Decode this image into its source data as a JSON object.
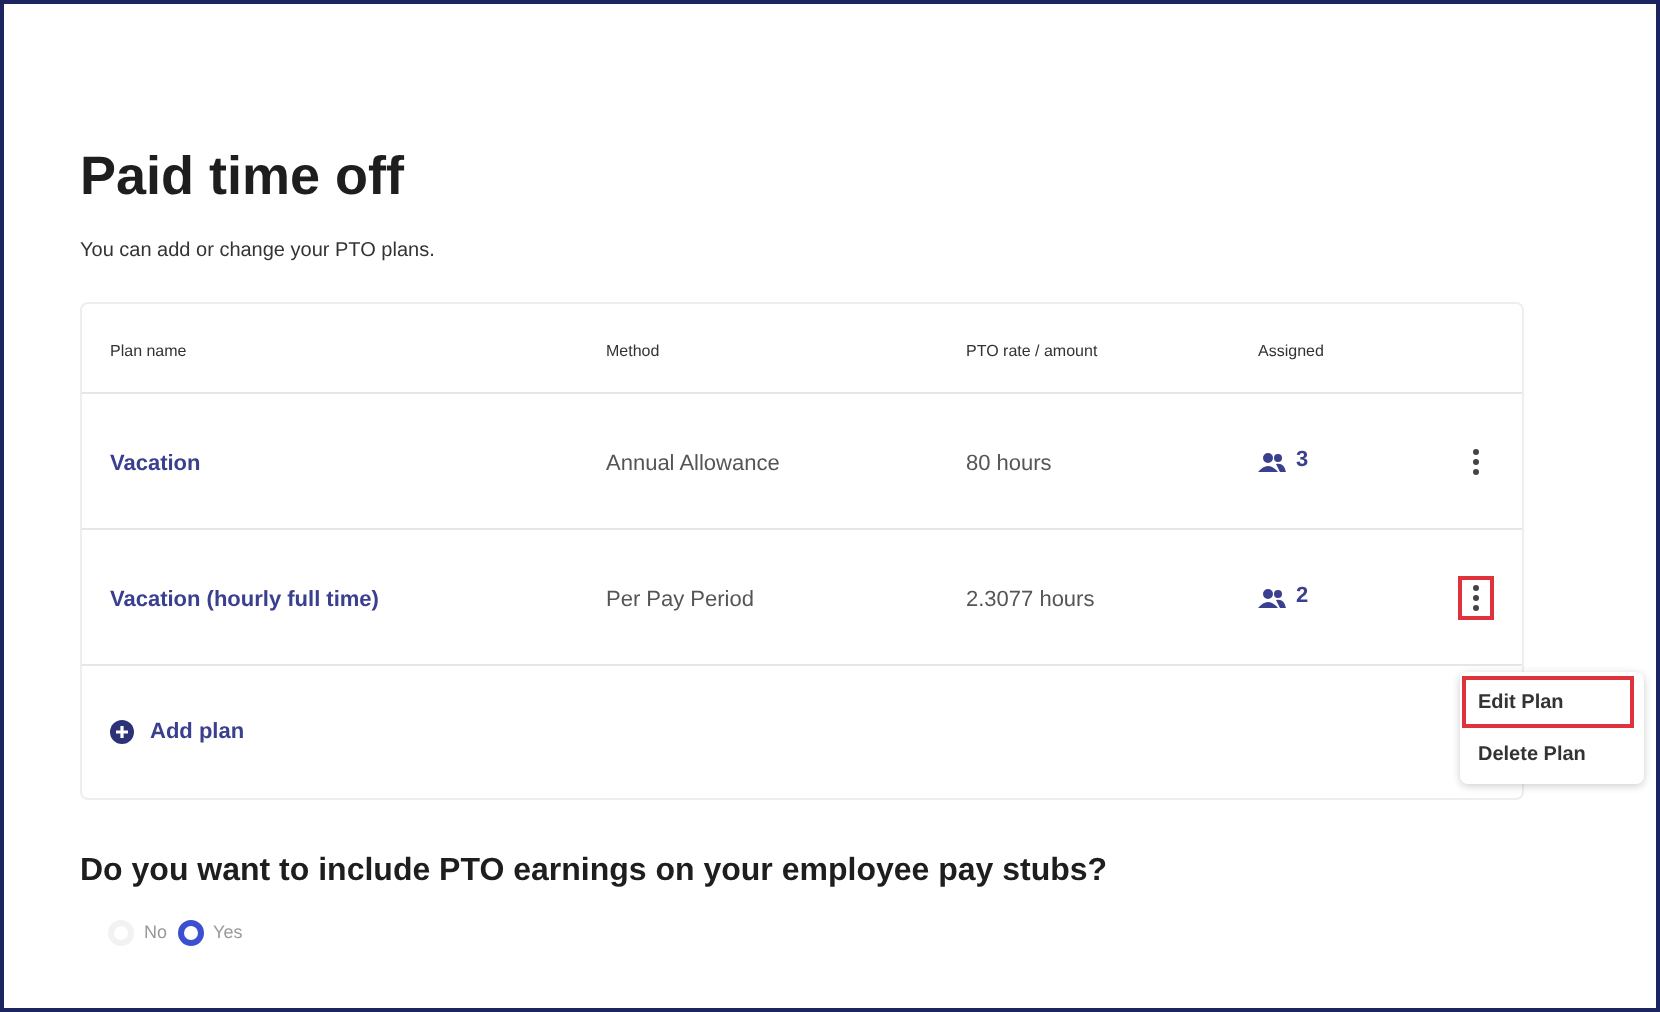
{
  "title": "Paid time off",
  "subtitle": "You can add or change your PTO plans.",
  "table": {
    "columns": [
      "Plan name",
      "Method",
      "PTO rate / amount",
      "Assigned"
    ],
    "rows": [
      {
        "plan_name": "Vacation",
        "method": "Annual Allowance",
        "rate": "80 hours",
        "assigned": "3",
        "menu_highlighted": false
      },
      {
        "plan_name": "Vacation (hourly full time)",
        "method": "Per Pay Period",
        "rate": "2.3077 hours",
        "assigned": "2",
        "menu_highlighted": true
      }
    ]
  },
  "add_plan": "Add plan",
  "row_menu": {
    "items": [
      {
        "label": "Edit Plan",
        "highlighted": true
      },
      {
        "label": "Delete Plan",
        "highlighted": false
      }
    ]
  },
  "question": "Do you want to include PTO earnings on your employee pay stubs?",
  "options": [
    {
      "label": "No",
      "selected": false
    },
    {
      "label": "Yes",
      "selected": true
    }
  ]
}
